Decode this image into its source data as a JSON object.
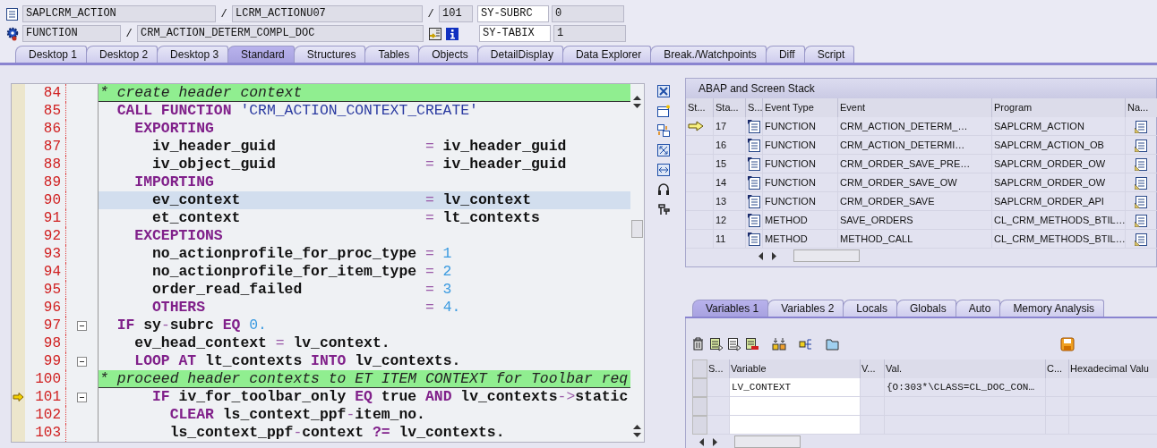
{
  "header": {
    "program": "SAPLCRM_ACTION",
    "include": "LCRM_ACTIONU07",
    "line": "101",
    "event_type": "FUNCTION",
    "event": "CRM_ACTION_DETERM_COMPL_DOC",
    "separators": [
      "/",
      "/",
      "/"
    ],
    "sysvars": [
      {
        "name": "SY-SUBRC",
        "value": "0"
      },
      {
        "name": "SY-TABIX",
        "value": "1"
      }
    ]
  },
  "tabs": [
    {
      "label": "Desktop 1",
      "selected": false
    },
    {
      "label": "Desktop 2",
      "selected": false
    },
    {
      "label": "Desktop 3",
      "selected": false
    },
    {
      "label": "Standard",
      "selected": true
    },
    {
      "label": "Structures",
      "selected": false
    },
    {
      "label": "Tables",
      "selected": false
    },
    {
      "label": "Objects",
      "selected": false
    },
    {
      "label": "DetailDisplay",
      "selected": false
    },
    {
      "label": "Data Explorer",
      "selected": false
    },
    {
      "label": "Break./Watchpoints",
      "selected": false
    },
    {
      "label": "Diff",
      "selected": false
    },
    {
      "label": "Script",
      "selected": false
    }
  ],
  "editor": {
    "lines": [
      {
        "number": "84",
        "current": false,
        "pointer": false,
        "fold": false,
        "comment": true,
        "tokens": [
          {
            "kind": "comment",
            "text": "* create header context"
          }
        ]
      },
      {
        "number": "85",
        "current": false,
        "pointer": false,
        "fold": false,
        "comment": false,
        "tokens": [
          {
            "kind": "keyword",
            "text": "  CALL FUNCTION"
          },
          {
            "kind": "string",
            "text": " 'CRM_ACTION_CONTEXT_CREATE'"
          }
        ]
      },
      {
        "number": "86",
        "current": false,
        "pointer": false,
        "fold": false,
        "comment": false,
        "tokens": [
          {
            "kind": "keyword",
            "text": "    EXPORTING"
          }
        ]
      },
      {
        "number": "87",
        "current": false,
        "pointer": false,
        "fold": false,
        "comment": false,
        "tokens": [
          {
            "kind": "name",
            "text": "      iv_header_guid                 "
          },
          {
            "kind": "operator",
            "text": "="
          },
          {
            "kind": "name",
            "text": " iv_header_guid"
          }
        ]
      },
      {
        "number": "88",
        "current": false,
        "pointer": false,
        "fold": false,
        "comment": false,
        "tokens": [
          {
            "kind": "name",
            "text": "      iv_object_guid                 "
          },
          {
            "kind": "operator",
            "text": "="
          },
          {
            "kind": "name",
            "text": " iv_header_guid"
          }
        ]
      },
      {
        "number": "89",
        "current": false,
        "pointer": false,
        "fold": false,
        "comment": false,
        "tokens": [
          {
            "kind": "keyword",
            "text": "    IMPORTING"
          }
        ]
      },
      {
        "number": "90",
        "current": true,
        "pointer": false,
        "fold": false,
        "comment": false,
        "tokens": [
          {
            "kind": "name",
            "text": "      ev_context                     "
          },
          {
            "kind": "operator",
            "text": "="
          },
          {
            "kind": "name",
            "text": " lv_context"
          }
        ]
      },
      {
        "number": "91",
        "current": false,
        "pointer": false,
        "fold": false,
        "comment": false,
        "tokens": [
          {
            "kind": "name",
            "text": "      et_context                     "
          },
          {
            "kind": "operator",
            "text": "="
          },
          {
            "kind": "name",
            "text": " lt_contexts"
          }
        ]
      },
      {
        "number": "92",
        "current": false,
        "pointer": false,
        "fold": false,
        "comment": false,
        "tokens": [
          {
            "kind": "keyword",
            "text": "    EXCEPTIONS"
          }
        ]
      },
      {
        "number": "93",
        "current": false,
        "pointer": false,
        "fold": false,
        "comment": false,
        "tokens": [
          {
            "kind": "name",
            "text": "      no_actionprofile_for_proc_type "
          },
          {
            "kind": "operator",
            "text": "="
          },
          {
            "kind": "number",
            "text": " 1"
          }
        ]
      },
      {
        "number": "94",
        "current": false,
        "pointer": false,
        "fold": false,
        "comment": false,
        "tokens": [
          {
            "kind": "name",
            "text": "      no_actionprofile_for_item_type "
          },
          {
            "kind": "operator",
            "text": "="
          },
          {
            "kind": "number",
            "text": " 2"
          }
        ]
      },
      {
        "number": "95",
        "current": false,
        "pointer": false,
        "fold": false,
        "comment": false,
        "tokens": [
          {
            "kind": "name",
            "text": "      order_read_failed              "
          },
          {
            "kind": "operator",
            "text": "="
          },
          {
            "kind": "number",
            "text": " 3"
          }
        ]
      },
      {
        "number": "96",
        "current": false,
        "pointer": false,
        "fold": false,
        "comment": false,
        "tokens": [
          {
            "kind": "keyword",
            "text": "      OTHERS"
          },
          {
            "kind": "operator",
            "text": "                         ="
          },
          {
            "kind": "number",
            "text": " 4."
          }
        ]
      },
      {
        "number": "97",
        "current": false,
        "pointer": false,
        "fold": true,
        "comment": false,
        "tokens": [
          {
            "kind": "keyword",
            "text": "  IF"
          },
          {
            "kind": "name",
            "text": " sy"
          },
          {
            "kind": "operator",
            "text": "-"
          },
          {
            "kind": "name",
            "text": "subrc "
          },
          {
            "kind": "keyword",
            "text": "EQ"
          },
          {
            "kind": "number",
            "text": " 0."
          }
        ]
      },
      {
        "number": "98",
        "current": false,
        "pointer": false,
        "fold": false,
        "comment": false,
        "tokens": [
          {
            "kind": "name",
            "text": "    ev_head_context "
          },
          {
            "kind": "operator",
            "text": "="
          },
          {
            "kind": "name",
            "text": " lv_context."
          }
        ]
      },
      {
        "number": "99",
        "current": false,
        "pointer": false,
        "fold": true,
        "comment": false,
        "tokens": [
          {
            "kind": "keyword",
            "text": "    LOOP AT"
          },
          {
            "kind": "name",
            "text": " lt_contexts "
          },
          {
            "kind": "keyword",
            "text": "INTO"
          },
          {
            "kind": "name",
            "text": " lv_contexts."
          }
        ]
      },
      {
        "number": "100",
        "current": false,
        "pointer": false,
        "fold": false,
        "comment": true,
        "tokens": [
          {
            "kind": "comment",
            "text": "* proceed header contexts to ET ITEM CONTEXT for Toolbar req"
          }
        ]
      },
      {
        "number": "101",
        "current": false,
        "pointer": true,
        "fold": true,
        "comment": false,
        "tokens": [
          {
            "kind": "keyword",
            "text": "      IF"
          },
          {
            "kind": "name",
            "text": " iv_for_toolbar_only "
          },
          {
            "kind": "keyword",
            "text": "EQ"
          },
          {
            "kind": "name",
            "text": " true "
          },
          {
            "kind": "keyword",
            "text": "AND"
          },
          {
            "kind": "name",
            "text": " lv_contexts"
          },
          {
            "kind": "operator",
            "text": "->"
          },
          {
            "kind": "name",
            "text": "static"
          }
        ]
      },
      {
        "number": "102",
        "current": false,
        "pointer": false,
        "fold": false,
        "comment": false,
        "tokens": [
          {
            "kind": "keyword",
            "text": "        CLEAR"
          },
          {
            "kind": "name",
            "text": " ls_context_ppf"
          },
          {
            "kind": "operator",
            "text": "-"
          },
          {
            "kind": "name",
            "text": "item_no."
          }
        ]
      },
      {
        "number": "103",
        "current": false,
        "pointer": false,
        "fold": false,
        "comment": false,
        "tokens": [
          {
            "kind": "name",
            "text": "        ls_context_ppf"
          },
          {
            "kind": "operator",
            "text": "-"
          },
          {
            "kind": "name",
            "text": "context "
          },
          {
            "kind": "keyword",
            "text": "?="
          },
          {
            "kind": "name",
            "text": " lv_contexts."
          }
        ]
      }
    ]
  },
  "stack": {
    "title": "ABAP and Screen Stack",
    "columns": [
      "St...",
      "Sta...",
      "S...",
      "Event Type",
      "Event",
      "Program",
      "Na..."
    ],
    "rows": [
      {
        "current": true,
        "depth": "17",
        "event_type": "FUNCTION",
        "event": "CRM_ACTION_DETERM_…",
        "program": "SAPLCRM_ACTION"
      },
      {
        "current": false,
        "depth": "16",
        "event_type": "FUNCTION",
        "event": "CRM_ACTION_DETERMI…",
        "program": "SAPLCRM_ACTION_OB"
      },
      {
        "current": false,
        "depth": "15",
        "event_type": "FUNCTION",
        "event": "CRM_ORDER_SAVE_PRE…",
        "program": "SAPLCRM_ORDER_OW"
      },
      {
        "current": false,
        "depth": "14",
        "event_type": "FUNCTION",
        "event": "CRM_ORDER_SAVE_OW",
        "program": "SAPLCRM_ORDER_OW"
      },
      {
        "current": false,
        "depth": "13",
        "event_type": "FUNCTION",
        "event": "CRM_ORDER_SAVE",
        "program": "SAPLCRM_ORDER_API"
      },
      {
        "current": false,
        "depth": "12",
        "event_type": "METHOD",
        "event": "SAVE_ORDERS",
        "program": "CL_CRM_METHODS_BTIL…"
      },
      {
        "current": false,
        "depth": "11",
        "event_type": "METHOD",
        "event": "METHOD_CALL",
        "program": "CL_CRM_METHODS_BTIL…"
      }
    ]
  },
  "variables": {
    "tabs": [
      {
        "label": "Variables 1",
        "selected": true
      },
      {
        "label": "Variables 2",
        "selected": false
      },
      {
        "label": "Locals",
        "selected": false
      },
      {
        "label": "Globals",
        "selected": false
      },
      {
        "label": "Auto",
        "selected": false
      },
      {
        "label": "Memory Analysis",
        "selected": false
      }
    ],
    "columns": [
      "S...",
      "Variable",
      "V...",
      "Val.",
      "C...",
      "Hexadecimal Valu"
    ],
    "rows": [
      {
        "variable": "LV_CONTEXT",
        "value": "{O:303*\\CLASS=CL_DOC_CON…"
      }
    ]
  }
}
